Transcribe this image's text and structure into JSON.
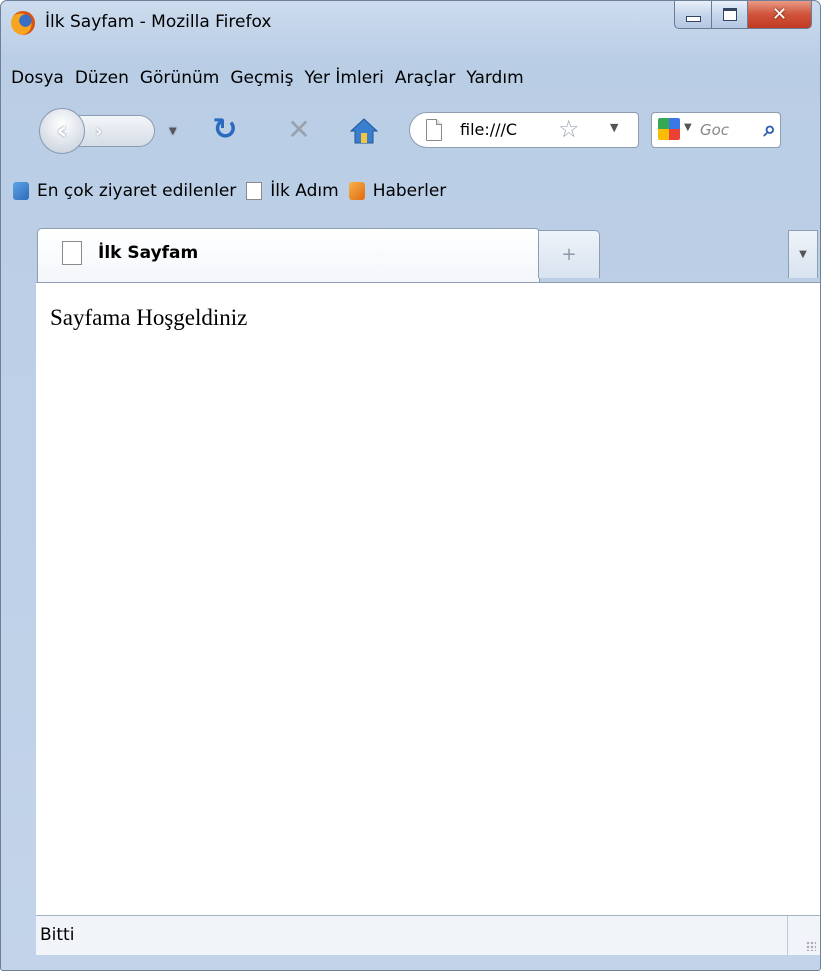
{
  "window": {
    "title": "İlk Sayfam - Mozilla Firefox"
  },
  "menu": {
    "items": [
      "Dosya",
      "Düzen",
      "Görünüm",
      "Geçmiş",
      "Yer İmleri",
      "Araçlar",
      "Yardım"
    ]
  },
  "navigation": {
    "url": "file:///C",
    "search_placeholder": "Goc"
  },
  "bookmarks": {
    "items": [
      "En çok ziyaret edilenler",
      "İlk Adım",
      "Haberler"
    ]
  },
  "tabs": {
    "active_label": "İlk Sayfam",
    "new_tab_symbol": "+"
  },
  "content": {
    "text": "Sayfama Hoşgeldiniz"
  },
  "status": {
    "text": "Bitti"
  },
  "icons": {
    "window": "firefox-logo-icon",
    "back": "back-arrow-icon",
    "forward": "forward-arrow-icon",
    "reload": "reload-icon",
    "stop": "stop-icon",
    "home": "home-icon",
    "bookmark_star": "star-icon",
    "search_engine": "google-icon",
    "search": "magnifier-icon"
  }
}
